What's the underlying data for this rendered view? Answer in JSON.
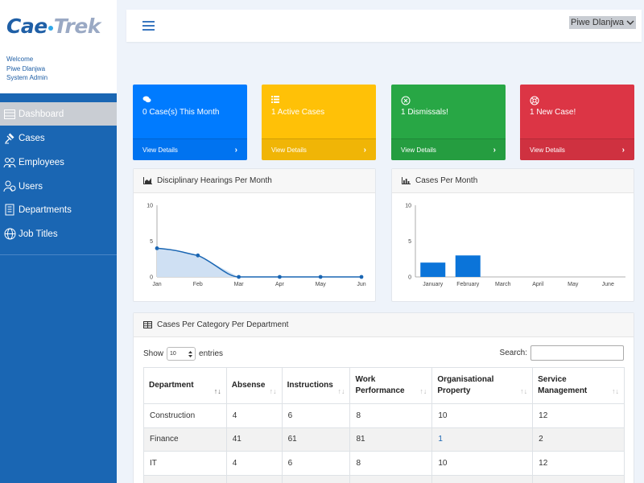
{
  "brand": {
    "part1": "Ca",
    "part2": "e",
    "part3": "Trek"
  },
  "welcome": {
    "line1": "Welcome",
    "name": "Piwe Dlanjwa",
    "role": "System Admin"
  },
  "nav": [
    {
      "label": "Dashboard",
      "icon": "dashboard-icon",
      "active": true
    },
    {
      "label": "Cases",
      "icon": "gavel-icon"
    },
    {
      "label": "Employees",
      "icon": "employees-icon"
    },
    {
      "label": "Users",
      "icon": "users-icon"
    },
    {
      "label": "Departments",
      "icon": "building-icon"
    },
    {
      "label": "Job Titles",
      "icon": "globe-icon"
    }
  ],
  "topbar": {
    "user": "Piwe Dlanjwa"
  },
  "cards": [
    {
      "icon": "comments-icon",
      "title": "0 Case(s) This Month",
      "link": "View Details",
      "color": "#007bff"
    },
    {
      "icon": "list-icon",
      "title": "1 Active Cases",
      "link": "View Details",
      "color": "#ffc107"
    },
    {
      "icon": "times-circle-icon",
      "title": "1 Dismissals!",
      "link": "View Details",
      "color": "#28a745"
    },
    {
      "icon": "life-ring-icon",
      "title": "1 New Case!",
      "link": "View Details",
      "color": "#dc3545"
    }
  ],
  "panels": {
    "hearings_title": "Disciplinary Hearings Per Month",
    "cases_title": "Cases Per Month",
    "table_title": "Cases Per Category Per Department"
  },
  "chart_data": [
    {
      "type": "area",
      "x": [
        "Jan",
        "Feb",
        "Mar",
        "Apr",
        "May",
        "Jun"
      ],
      "values": [
        4,
        3,
        0,
        0,
        0,
        0
      ],
      "ylim": [
        0,
        10
      ],
      "yticks": [
        0,
        5,
        10
      ],
      "color": "#1a66b3",
      "fill": "#cfe0f3",
      "grid": false
    },
    {
      "type": "bar",
      "categories": [
        "January",
        "February",
        "March",
        "April",
        "May",
        "June"
      ],
      "values": [
        2,
        3,
        0,
        0,
        0,
        0
      ],
      "ylim": [
        0,
        10
      ],
      "yticks": [
        0,
        5,
        10
      ],
      "color": "#0b74d9",
      "grid": false
    }
  ],
  "table": {
    "show_label": "Show",
    "entries_value": "10",
    "entries_label": "entries",
    "search_label": "Search:",
    "columns": [
      "Department",
      "Absense",
      "Instructions",
      "Work Performance",
      "Organisational Property",
      "Service Management"
    ],
    "rows": [
      [
        "Construction",
        "4",
        "6",
        "8",
        "10",
        "12"
      ],
      [
        "Finance",
        "41",
        "61",
        "81",
        "1",
        "2"
      ],
      [
        "IT",
        "4",
        "6",
        "8",
        "10",
        "12"
      ]
    ]
  }
}
